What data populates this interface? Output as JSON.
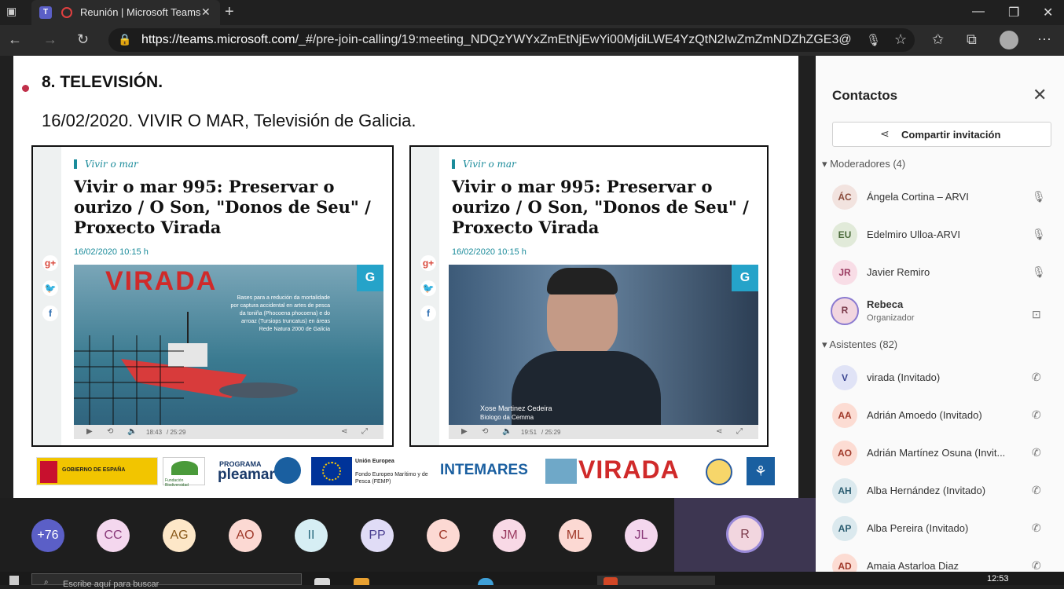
{
  "browser": {
    "tab_title": "Reunión | Microsoft Teams",
    "url_host": "https://teams.microsoft.com",
    "url_path": "/_#/pre-join-calling/19:meeting_NDQzYWYxZmEtNjEwYi00MjdiLWE4YzQtN2IwZmZmNDZhZGE3@..."
  },
  "slide": {
    "heading": "8. TELEVISIÓN.",
    "subheading": "16/02/2020. VIVIR O MAR, Televisión de Galicia.",
    "screenshots": [
      {
        "category": "Vivir o mar",
        "headline": "Vivir o mar 995: Preservar o ourizo / O Son, \"Donos de Seu\" / Proxecto Virada",
        "date": "16/02/2020 10:15 h",
        "video_title": "VIRADA",
        "video_caption": "Bases para a redución da mortalidade por captura accidental en artes de pesca da toniña (Phocoena phocoena) e do arroaz (Tursiops truncatus) en áreas Rede Natura 2000 de Galicia",
        "time": "18:43",
        "duration": "/ 25:29"
      },
      {
        "category": "Vivir o mar",
        "headline": "Vivir o mar 995: Preservar o ourizo / O Son, \"Donos de Seu\" / Proxecto Virada",
        "date": "16/02/2020 10:15 h",
        "lower_third_name": "Xose Martinez Cedeira",
        "lower_third_role": "Biologo da Cemma",
        "time": "19:51",
        "duration": "/ 25:29"
      }
    ],
    "logos": {
      "gobierno": "GOBIERNO DE ESPAÑA",
      "fundacion": "Fundación Biodiversidad",
      "pleamar_top": "PROGRAMA",
      "pleamar": "pleamar",
      "ue_title": "Unión Europea",
      "ue_sub": "Fondo Europeo Marítimo y de Pesca (FEMP)",
      "intemares": "INTEMARES",
      "virada": "VIRADA"
    }
  },
  "participants_strip": [
    {
      "initials": "+76",
      "bg": "#5b5fc7",
      "fg": "#ffffff"
    },
    {
      "initials": "CC",
      "bg": "#f4d7ee",
      "fg": "#8a3a7a"
    },
    {
      "initials": "AG",
      "bg": "#fde7c8",
      "fg": "#8a5a1a"
    },
    {
      "initials": "AO",
      "bg": "#fcd9d3",
      "fg": "#a0392a"
    },
    {
      "initials": "II",
      "bg": "#d6eef4",
      "fg": "#2a6c80"
    },
    {
      "initials": "PP",
      "bg": "#e0dcf6",
      "fg": "#4a3f91"
    },
    {
      "initials": "C",
      "bg": "#fcd9d3",
      "fg": "#a0392a"
    },
    {
      "initials": "JM",
      "bg": "#f8d9e6",
      "fg": "#9a3a60"
    },
    {
      "initials": "ML",
      "bg": "#fcd9d3",
      "fg": "#a0392a"
    },
    {
      "initials": "JL",
      "bg": "#f4d7ee",
      "fg": "#8a3a7a"
    }
  ],
  "self": {
    "initials": "R"
  },
  "panel": {
    "title": "Contactos",
    "share_label": "Compartir invitación",
    "moderators_header": "Moderadores (4)",
    "attendees_header": "Asistentes (82)",
    "moderators": [
      {
        "initials": "ÁC",
        "name": "Ángela Cortina – ARVI",
        "bg": "#f2e3df",
        "fg": "#8a4a3a"
      },
      {
        "initials": "EU",
        "name": "Edelmiro Ulloa-ARVI",
        "bg": "#e1ead9",
        "fg": "#4a6a3a"
      },
      {
        "initials": "JR",
        "name": "Javier Remiro",
        "bg": "#f8dde6",
        "fg": "#9a3a60"
      }
    ],
    "organizer": {
      "initials": "R",
      "name": "Rebeca",
      "role": "Organizador"
    },
    "attendees": [
      {
        "initials": "V",
        "name": "virada (Invitado)",
        "bg": "#e0e3f6",
        "fg": "#3a4591"
      },
      {
        "initials": "AA",
        "name": "Adrián Amoedo (Invitado)",
        "bg": "#fcdcd3",
        "fg": "#a0392a"
      },
      {
        "initials": "AO",
        "name": "Adrián Martínez Osuna (Invit...",
        "bg": "#fcdcd3",
        "fg": "#a0392a"
      },
      {
        "initials": "AH",
        "name": "Alba Hernández (Invitado)",
        "bg": "#dbe9ee",
        "fg": "#2a5c70"
      },
      {
        "initials": "AP",
        "name": "Alba Pereira (Invitado)",
        "bg": "#dbe9ee",
        "fg": "#2a5c70"
      },
      {
        "initials": "AD",
        "name": "Amaia Astarloa Diaz",
        "bg": "#fcdcd3",
        "fg": "#a0392a"
      }
    ]
  },
  "taskbar": {
    "search_placeholder": "Escribe aquí para buscar",
    "time": "12:53"
  }
}
